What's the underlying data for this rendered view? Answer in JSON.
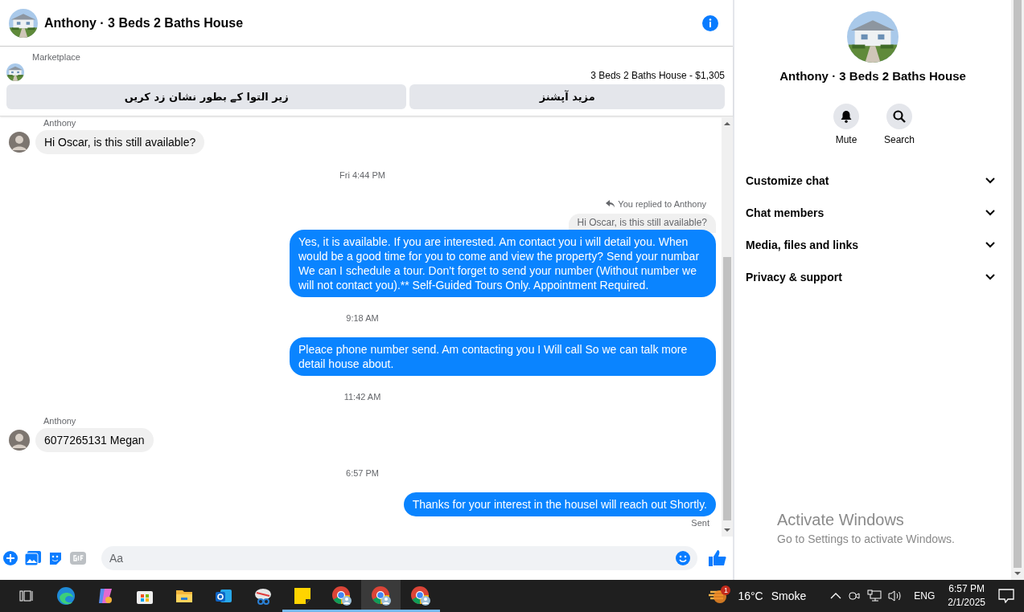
{
  "header": {
    "title": "Anthony · 3 Beds 2 Baths House"
  },
  "listing": {
    "source": "Marketplace",
    "summary": "3 Beds 2 Baths House - $1,305",
    "actions": [
      {
        "label": "مزید آپشنز"
      },
      {
        "label": "زیر التوا کے بطور نشان زد کریں"
      }
    ]
  },
  "messages": [
    {
      "kind": "incoming",
      "sender": "Anthony",
      "text": "Hi Oscar, is this still available?"
    },
    {
      "kind": "time",
      "text": "Fri 4:44 PM"
    },
    {
      "kind": "outgoing",
      "reply_note": "You replied to Anthony",
      "quote": "Hi Oscar, is this still available?",
      "text": "Yes, it is available. If you are interested. Am contact you i will detail you. When would be a good time for you to come and view the property? Send your numbar We can I schedule a tour. Don't forget to send your number (Without number we will not contact you).** Self-Guided Tours Only. Appointment Required."
    },
    {
      "kind": "time",
      "text": "9:18 AM"
    },
    {
      "kind": "outgoing",
      "text": "Pleace phone number send. Am contacting you I Will call So we can talk more detail house about."
    },
    {
      "kind": "time",
      "text": "11:42 AM"
    },
    {
      "kind": "incoming",
      "sender": "Anthony",
      "text": "6077265131 Megan"
    },
    {
      "kind": "time",
      "text": "6:57 PM"
    },
    {
      "kind": "outgoing",
      "text": "Thanks for your interest in the housel will reach out Shortly.",
      "status": "Sent"
    }
  ],
  "composer": {
    "placeholder": "Aa"
  },
  "details": {
    "title": "Anthony · 3 Beds 2 Baths House",
    "actions": [
      {
        "kind": "mute",
        "label": "Mute"
      },
      {
        "kind": "search",
        "label": "Search"
      }
    ],
    "sections": [
      {
        "label": "Customize chat",
        "expanded": false
      },
      {
        "label": "Chat members",
        "expanded": false
      },
      {
        "label": "Media, files and links",
        "expanded": false
      },
      {
        "label": "Privacy & support",
        "expanded": false
      }
    ]
  },
  "activation": {
    "title": "Activate Windows",
    "subtitle": "Go to Settings to activate Windows."
  },
  "taskbar": {
    "apps": [
      {
        "kind": "taskview",
        "running": false,
        "selected": false
      },
      {
        "kind": "edge",
        "running": false,
        "selected": false
      },
      {
        "kind": "copilot",
        "running": false,
        "selected": false
      },
      {
        "kind": "store",
        "running": false,
        "selected": false
      },
      {
        "kind": "explorer",
        "running": false,
        "selected": false
      },
      {
        "kind": "outlook",
        "running": false,
        "selected": false
      },
      {
        "kind": "snip",
        "running": false,
        "selected": false
      },
      {
        "kind": "notes",
        "running": true,
        "selected": false
      },
      {
        "kind": "chrome",
        "running": true,
        "selected": false
      },
      {
        "kind": "chrome",
        "running": true,
        "selected": true
      },
      {
        "kind": "chrome",
        "running": true,
        "selected": false
      }
    ],
    "weather": {
      "badge": "1",
      "temperature": "16°C",
      "condition": "Smoke"
    },
    "language": "ENG",
    "time": "6:57 PM",
    "date": "2/1/2025"
  }
}
